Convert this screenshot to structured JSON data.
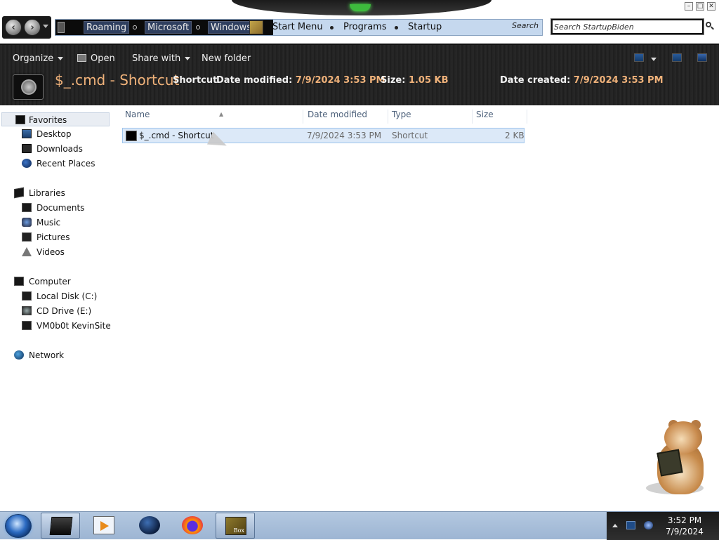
{
  "window": {
    "controls": {
      "minimize": "–",
      "maximize": "□",
      "close": "✕"
    }
  },
  "address": {
    "crumbs_dark": [
      "Roaming",
      "Microsoft",
      "Windows"
    ],
    "crumbs_light": [
      "Start Menu",
      "Programs",
      "Startup"
    ],
    "search_go_label": "Search"
  },
  "search": {
    "value": "Search StartupBiden",
    "placeholder": "Search StartupBiden"
  },
  "toolbar": {
    "organize": "Organize",
    "open": "Open",
    "share_with": "Share with",
    "new_folder": "New folder"
  },
  "details": {
    "name": "$_.cmd - Shortcut",
    "type": "Shortcut",
    "date_modified_label": "Date modified:",
    "date_modified": "7/9/2024 3:53 PM",
    "size_label": "Size:",
    "size": "1.05 KB",
    "date_created_label": "Date created:",
    "date_created": "7/9/2024 3:53 PM"
  },
  "navpane": {
    "favorites": {
      "label": "Favorites",
      "items": [
        "Desktop",
        "Downloads",
        "Recent Places"
      ]
    },
    "libraries": {
      "label": "Libraries",
      "items": [
        "Documents",
        "Music",
        "Pictures",
        "Videos"
      ]
    },
    "computer": {
      "label": "Computer",
      "items": [
        "Local Disk (C:)",
        "CD Drive (E:)",
        "VM0b0t KevinSite"
      ]
    },
    "network": {
      "label": "Network"
    }
  },
  "filelist": {
    "columns": [
      "Name",
      "Date modified",
      "Type",
      "Size"
    ],
    "rows": [
      {
        "name": "$_.cmd - Shortcut",
        "date_modified": "7/9/2024 3:53 PM",
        "type": "Shortcut",
        "size": "2 KB"
      }
    ]
  },
  "taskbar": {
    "box_app_label": "Box",
    "clock_time": "3:52 PM",
    "clock_date": "7/9/2024"
  },
  "colors": {
    "accent_orange": "#f0b27a",
    "selection_bg": "#dce9f8",
    "taskbar": "#a9bfdb"
  }
}
